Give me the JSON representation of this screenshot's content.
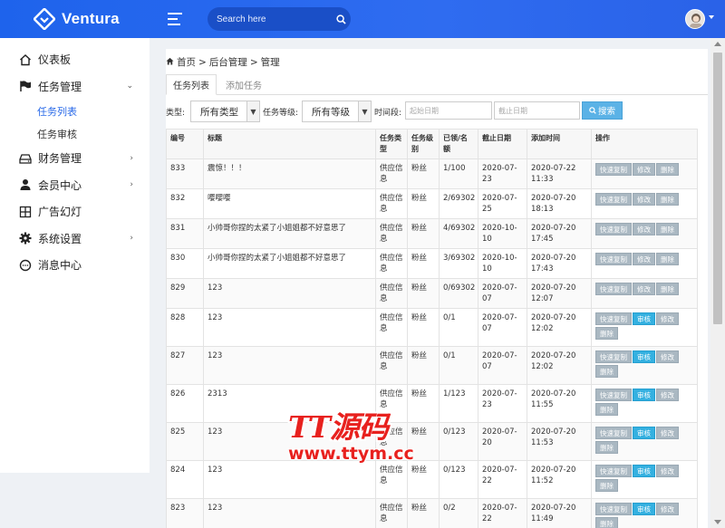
{
  "app": {
    "brand": "Ventura",
    "search_placeholder": "Search here"
  },
  "sidebar": {
    "items": [
      {
        "label": "仪表板",
        "icon": "home-icon"
      },
      {
        "label": "任务管理",
        "icon": "flag-icon"
      },
      {
        "label": "财务管理",
        "icon": "drive-icon"
      },
      {
        "label": "会员中心",
        "icon": "user-icon"
      },
      {
        "label": "广告幻灯",
        "icon": "grid-icon"
      },
      {
        "label": "系统设置",
        "icon": "gear-icon"
      },
      {
        "label": "消息中心",
        "icon": "chat-icon"
      }
    ],
    "sub_items": [
      {
        "label": "任务列表"
      },
      {
        "label": "任务审核"
      }
    ]
  },
  "breadcrumb": {
    "home": "首页",
    "sep": ">",
    "level2": "后台管理",
    "level3": "管理"
  },
  "tabs": {
    "list": "任务列表",
    "add": "添加任务"
  },
  "filters": {
    "type_label": "类型:",
    "type_value": "所有类型",
    "level_label": "任务等级:",
    "level_value": "所有等级",
    "period_label": "时间段:",
    "start_placeholder": "起始日期",
    "end_placeholder": "截止日期",
    "search_button": "搜索"
  },
  "table": {
    "headers": [
      "编号",
      "标题",
      "任务类型",
      "任务级别",
      "已领/名额",
      "截止日期",
      "添加时间",
      "操作"
    ],
    "actions": {
      "copy": "快速复制",
      "review": "审核",
      "edit": "修改",
      "delete": "删除"
    },
    "rows": [
      {
        "id": "833",
        "title": "震惊！！！",
        "type": "供应信息",
        "level": "粉丝",
        "quota": "1/100",
        "deadline": "2020-07-23",
        "added": "2020-07-22 11:33"
      },
      {
        "id": "832",
        "title": "嘤嘤嘤",
        "type": "供应信息",
        "level": "粉丝",
        "quota": "2/69302",
        "deadline": "2020-07-25",
        "added": "2020-07-20 18:13"
      },
      {
        "id": "831",
        "title": "小帅哥你捏的太紧了小姐姐都不好意思了",
        "type": "供应信息",
        "level": "粉丝",
        "quota": "4/69302",
        "deadline": "2020-10-10",
        "added": "2020-07-20 17:45"
      },
      {
        "id": "830",
        "title": "小帅哥你捏的太紧了小姐姐都不好意思了",
        "type": "供应信息",
        "level": "粉丝",
        "quota": "3/69302",
        "deadline": "2020-10-10",
        "added": "2020-07-20 17:43"
      },
      {
        "id": "829",
        "title": "123",
        "type": "供应信息",
        "level": "粉丝",
        "quota": "0/69302",
        "deadline": "2020-07-07",
        "added": "2020-07-20 12:07"
      },
      {
        "id": "828",
        "title": "123",
        "type": "供应信息",
        "level": "粉丝",
        "quota": "0/1",
        "deadline": "2020-07-07",
        "added": "2020-07-20 12:02"
      },
      {
        "id": "827",
        "title": "123",
        "type": "供应信息",
        "level": "粉丝",
        "quota": "0/1",
        "deadline": "2020-07-07",
        "added": "2020-07-20 12:02"
      },
      {
        "id": "826",
        "title": "2313",
        "type": "供应信息",
        "level": "粉丝",
        "quota": "1/123",
        "deadline": "2020-07-23",
        "added": "2020-07-20 11:55"
      },
      {
        "id": "825",
        "title": "123",
        "type": "供应信息",
        "level": "粉丝",
        "quota": "0/123",
        "deadline": "2020-07-20",
        "added": "2020-07-20 11:53"
      },
      {
        "id": "824",
        "title": "123",
        "type": "供应信息",
        "level": "粉丝",
        "quota": "0/123",
        "deadline": "2020-07-22",
        "added": "2020-07-20 11:52"
      },
      {
        "id": "823",
        "title": "123",
        "type": "供应信息",
        "level": "粉丝",
        "quota": "0/2",
        "deadline": "2020-07-22",
        "added": "2020-07-20 11:49"
      }
    ]
  },
  "watermark": {
    "top": "TT源码",
    "bottom": "www.ttym.cc"
  },
  "colors": {
    "topbar": "#2f6cf0",
    "accent": "#2a6ae8",
    "search_btn": "#5bb2e6",
    "action_btn": "#aab8c2",
    "review_btn": "#34b0e0",
    "watermark": "#e8211e"
  }
}
